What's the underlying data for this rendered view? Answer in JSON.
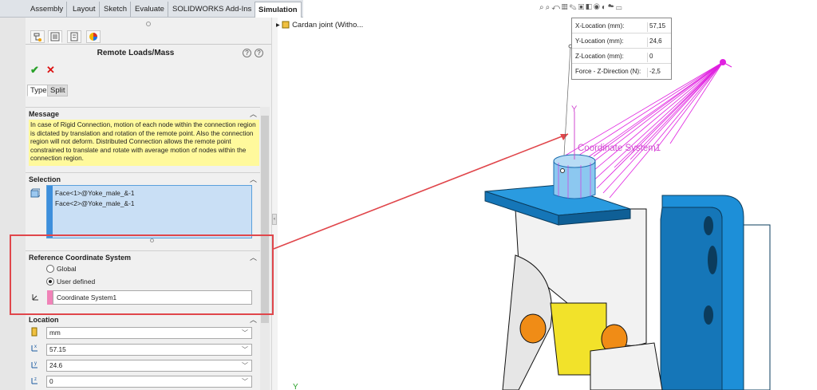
{
  "command_tabs": [
    "Assembly",
    "Layout",
    "Sketch",
    "Evaluate",
    "SOLIDWORKS Add-Ins",
    "Simulation"
  ],
  "property_manager": {
    "title": "Remote Loads/Mass",
    "tabs": [
      "Type",
      "Split"
    ],
    "message": {
      "header": "Message",
      "text": "In case of Rigid Connection, motion of each node within the connection region is dictated by translation and rotation of the remote point. Also the connection region will not deform. Distributed Connection allows the remote point constrained to translate and rotate with average motion of nodes within the connection region."
    },
    "selection": {
      "header": "Selection",
      "items": [
        "Face<1>@Yoke_male_&-1",
        "Face<2>@Yoke_male_&-1"
      ]
    },
    "reference_cs": {
      "header": "Reference Coordinate System",
      "options": [
        "Global",
        "User defined"
      ],
      "selected": "User defined",
      "coordinate_system": "Coordinate System1"
    },
    "location": {
      "header": "Location",
      "unit": "mm",
      "x": "57.15",
      "y": "24.6",
      "z": "0"
    }
  },
  "tree": {
    "item": "Cardan joint  (Witho..."
  },
  "tooltip": {
    "rows": [
      {
        "label": "X-Location (mm):",
        "value": "57,15"
      },
      {
        "label": "Y-Location (mm):",
        "value": "24,6"
      },
      {
        "label": "Z-Location (mm):",
        "value": "0"
      },
      {
        "label": "Force -  Z-Direction (N):",
        "value": "-2,5"
      }
    ]
  },
  "graphics": {
    "cs_label": "Coordinate System1",
    "axis_y": "Y",
    "axis_y_bottom": "Y"
  },
  "colors": {
    "accent_blue": "#3d8fdc",
    "message_yellow": "#fff99c",
    "highlight_red": "#e0464b",
    "remote_magenta": "#e021e0",
    "part_blue": "#1d8fd8",
    "hole_orange": "#f08c16",
    "face_yellow": "#f2e22a"
  }
}
